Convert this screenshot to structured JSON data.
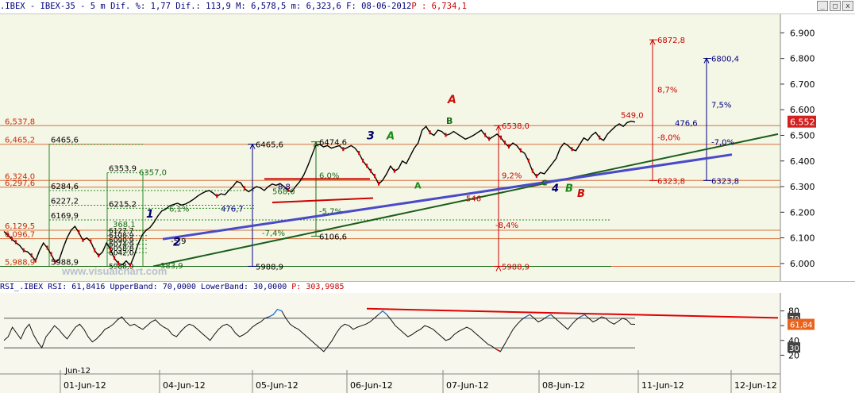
{
  "window": {
    "title_prefix": ".IBEX - IBEX-35 -  5 m Dif. %: 1,77 Dif.: 113,9 M: 6,578,5 m: 6,323,6 F: 08-06-2012",
    "title_price": " P : 6,734,1",
    "min_label": "_",
    "max_label": "□",
    "close_label": "x"
  },
  "colors": {
    "price_panel_bg": "#f4f7e6",
    "rsi_panel_bg": "#f7f7ee",
    "price_line": "#000000",
    "red": "#cc0000",
    "blue_trend": "#4a4ac8",
    "green_trend": "#1a5e1a",
    "current_price_bg": "#d32020"
  },
  "watermark": "www.visualchart.com",
  "chart_data": [
    {
      "type": "line",
      "name": "IBEX-35 5m",
      "ylim": [
        5950,
        6960
      ],
      "y_ticks": [
        "6.900",
        "6.800",
        "6.700",
        "6.600",
        "6.500",
        "6.400",
        "6.300",
        "6.200",
        "6.100",
        "6.000"
      ],
      "current_price_label": "6.552",
      "x_labels": [
        "01-Jun-12",
        "04-Jun-12",
        "05-Jun-12",
        "06-Jun-12",
        "07-Jun-12",
        "08-Jun-12",
        "11-Jun-12",
        "12-Jun-12"
      ],
      "x_start_label": "Jun-12",
      "series": [
        {
          "values": [
            6125,
            6110,
            6095,
            6082,
            6070,
            6050,
            6045,
            6030,
            6010,
            6050,
            6080,
            6060,
            6035,
            6005,
            6015,
            6060,
            6100,
            6130,
            6145,
            6120,
            6090,
            6100,
            6085,
            6050,
            6030,
            6045,
            6080,
            6055,
            6020,
            6000,
            5995,
            6010,
            5992,
            6030,
            6075,
            6110,
            6130,
            6140,
            6160,
            6185,
            6205,
            6212,
            6225,
            6230,
            6235,
            6228,
            6232,
            6240,
            6250,
            6262,
            6272,
            6280,
            6285,
            6275,
            6262,
            6272,
            6268,
            6285,
            6300,
            6320,
            6315,
            6292,
            6280,
            6290,
            6300,
            6295,
            6285,
            6300,
            6310,
            6305,
            6312,
            6300,
            6285,
            6280,
            6302,
            6320,
            6345,
            6380,
            6420,
            6460,
            6465,
            6455,
            6460,
            6450,
            6455,
            6460,
            6445,
            6452,
            6460,
            6450,
            6430,
            6400,
            6380,
            6360,
            6340,
            6310,
            6325,
            6350,
            6380,
            6360,
            6370,
            6400,
            6390,
            6420,
            6450,
            6470,
            6520,
            6535,
            6510,
            6500,
            6520,
            6515,
            6500,
            6505,
            6515,
            6505,
            6495,
            6485,
            6492,
            6500,
            6510,
            6520,
            6500,
            6485,
            6495,
            6505,
            6490,
            6470,
            6455,
            6470,
            6460,
            6440,
            6430,
            6400,
            6360,
            6340,
            6355,
            6350,
            6370,
            6390,
            6410,
            6450,
            6470,
            6460,
            6445,
            6440,
            6465,
            6490,
            6480,
            6500,
            6512,
            6490,
            6480,
            6505,
            6520,
            6535,
            6545,
            6535,
            6550,
            6555,
            6552
          ]
        }
      ],
      "horizontal_levels": [
        {
          "label": "6,537,8",
          "value": 6537.8
        },
        {
          "label": "6,465,2",
          "value": 6465.2
        },
        {
          "label": "6,324,0",
          "value": 6324.0
        },
        {
          "label": "6,297,6",
          "value": 6297.6
        },
        {
          "label": "6,129,5",
          "value": 6129.5
        },
        {
          "label": "6,096,7",
          "value": 6096.7
        },
        {
          "label": "5,988,9",
          "value": 5988.9
        }
      ],
      "fib_levels": [
        {
          "label": "6465,6",
          "value": 6465.6
        },
        {
          "label": "6353,9",
          "value": 6353.9
        },
        {
          "label": "6284,6",
          "value": 6284.6
        },
        {
          "label": "6227,2",
          "value": 6227.2
        },
        {
          "label": "6215,2",
          "value": 6215.2
        },
        {
          "label": "6169,9",
          "value": 6169.9
        },
        {
          "label": "6127,7",
          "value": 6127.7
        },
        {
          "label": "6108,9",
          "value": 6108.9
        },
        {
          "label": "6090,9",
          "value": 6090.9
        },
        {
          "label": "6074,9",
          "value": 6074.9
        },
        {
          "label": "6058,8",
          "value": 6058.8
        },
        {
          "label": "6042,0",
          "value": 6042.0
        },
        {
          "label": "5988,9",
          "value": 5988.9
        },
        {
          "label": "5988,9",
          "value": 5988.9
        }
      ],
      "annotations": [
        {
          "text": "6357,0",
          "value": 6357.0,
          "color": "#1a6b1a"
        },
        {
          "text": "6465,6",
          "value": 6465.6,
          "color": "#000000"
        },
        {
          "text": "6474,6",
          "value": 6474.6,
          "color": "#000000"
        },
        {
          "text": "6106,6",
          "value": 6106.6,
          "color": "#000000"
        },
        {
          "text": "5988,9",
          "value": 5988.9,
          "color": "#000000"
        },
        {
          "text": "6538,0",
          "value": 6538.0,
          "color": "#cc0000"
        },
        {
          "text": "5988,9",
          "value": 5988.9,
          "color": "#cc0000"
        },
        {
          "text": "6872,8",
          "value": 6872.8,
          "color": "#cc0000"
        },
        {
          "text": "6323,8",
          "value": 6323.8,
          "color": "#cc0000"
        },
        {
          "text": "6800,4",
          "value": 6800.4,
          "color": "#000080"
        },
        {
          "text": "6323,8",
          "value": 6323.8,
          "color": "#000080"
        },
        {
          "text": "549,0",
          "value": 6580,
          "color": "#cc0000"
        },
        {
          "text": "476,6",
          "value": 6550,
          "color": "#000080"
        },
        {
          "text": "8,7%",
          "value": 6680,
          "color": "#cc0000"
        },
        {
          "text": "7,5%",
          "value": 6620,
          "color": "#000080"
        },
        {
          "text": "-8,0%",
          "value": 6493,
          "color": "#cc0000"
        },
        {
          "text": "-7,0%",
          "value": 6475,
          "color": "#000080"
        },
        {
          "text": "9,2%",
          "value": 6345,
          "color": "#cc0000"
        },
        {
          "text": "-8,4%",
          "value": 6152,
          "color": "#cc0000"
        },
        {
          "text": "546",
          "value": 6255,
          "color": "#cc0000"
        },
        {
          "text": "476,7",
          "value": 6215,
          "color": "#000080"
        },
        {
          "text": "6,0%",
          "value": 6345,
          "color": "#1a6b1a"
        },
        {
          "text": "-5,7%",
          "value": 6205,
          "color": "#1a6b1a"
        },
        {
          "text": "6,1%",
          "value": 6215,
          "color": "#1a6b1a"
        },
        {
          "text": "-7,4%",
          "value": 6120,
          "color": "#1a6b1a"
        },
        {
          "text": "8,8",
          "value": 6302,
          "color": "#000080"
        },
        {
          "text": "568,0",
          "value": 6283,
          "color": "#1a6b1a"
        },
        {
          "text": "368,1",
          "value": 6155,
          "color": "#1a6b1a"
        },
        {
          "text": "-5,9",
          "value": 6090,
          "color": "#000000"
        },
        {
          "text": "383,9",
          "value": 5993,
          "color": "#1a6b1a"
        }
      ],
      "wave_labels": [
        {
          "text": "1",
          "color": "#00006e"
        },
        {
          "text": "2",
          "color": "#00006e"
        },
        {
          "text": "3",
          "color": "#00006e"
        },
        {
          "text": "A",
          "color": "#1a8a1a"
        },
        {
          "text": "A",
          "color": "#1a8a1a"
        },
        {
          "text": "A",
          "color": "#cc1010"
        },
        {
          "text": "B",
          "color": "#1a6b1a"
        },
        {
          "text": "C",
          "color": "#1a6b1a"
        },
        {
          "text": "4",
          "color": "#00006e"
        },
        {
          "text": "B",
          "color": "#1a8a1a"
        },
        {
          "text": "B",
          "color": "#cc1010"
        }
      ]
    },
    {
      "type": "line",
      "name": "RSI",
      "header_prefix": "RSI_.IBEX RSI: 61,8416 UpperBand: 70,0000 LowerBand: 30,0000",
      "header_price": " P: 303,9985",
      "ylim": [
        0,
        100
      ],
      "y_ticks": [
        "80",
        "60",
        "40",
        "20"
      ],
      "upper_band": 70,
      "lower_band": 30,
      "upper_band_label": "70",
      "lower_band_label": "30",
      "current_value_label": "61,84",
      "series": [
        {
          "values": [
            40,
            45,
            58,
            50,
            42,
            55,
            62,
            48,
            38,
            30,
            45,
            52,
            60,
            55,
            48,
            42,
            50,
            58,
            62,
            55,
            45,
            38,
            42,
            48,
            55,
            58,
            62,
            68,
            72,
            65,
            60,
            62,
            58,
            55,
            60,
            65,
            68,
            62,
            58,
            55,
            48,
            45,
            52,
            58,
            62,
            60,
            55,
            50,
            45,
            40,
            48,
            55,
            60,
            62,
            58,
            50,
            45,
            48,
            52,
            58,
            62,
            65,
            70,
            72,
            75,
            82,
            80,
            70,
            62,
            58,
            55,
            50,
            45,
            40,
            35,
            30,
            25,
            32,
            40,
            50,
            58,
            62,
            60,
            55,
            58,
            60,
            62,
            65,
            70,
            75,
            80,
            75,
            68,
            60,
            55,
            50,
            45,
            48,
            52,
            55,
            60,
            58,
            55,
            50,
            45,
            40,
            42,
            48,
            52,
            55,
            58,
            55,
            50,
            45,
            40,
            35,
            32,
            28,
            25,
            35,
            45,
            55,
            62,
            68,
            72,
            75,
            70,
            65,
            68,
            72,
            75,
            70,
            65,
            60,
            55,
            62,
            68,
            72,
            75,
            70,
            65,
            68,
            72,
            70,
            65,
            62,
            66,
            70,
            68,
            62,
            61.84
          ]
        }
      ],
      "trendline_color": "#e00000"
    }
  ]
}
